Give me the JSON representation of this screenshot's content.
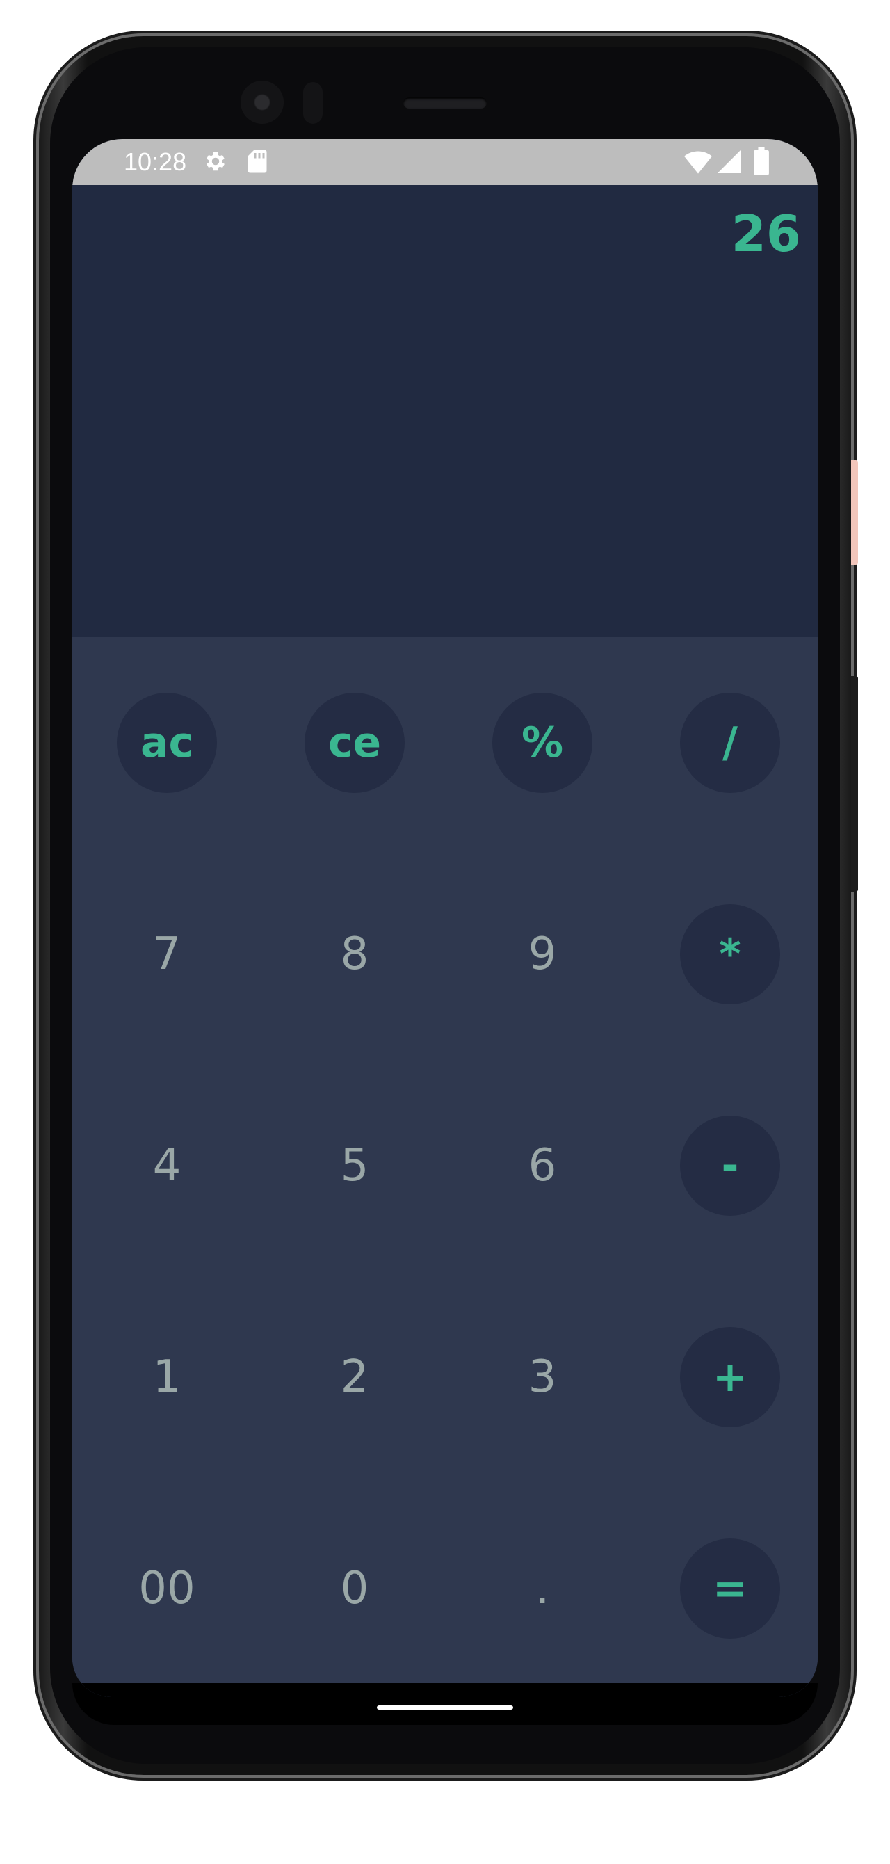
{
  "status_bar": {
    "time": "10:28",
    "icons": [
      "gear-icon",
      "sd-card-icon",
      "wifi-icon",
      "signal-icon",
      "battery-icon"
    ],
    "background": "#bdbdbd"
  },
  "display": {
    "value": "26",
    "background": "#212a41",
    "text_color": "#3ab690"
  },
  "keypad": {
    "background": "#2f384f",
    "operator_color": "#3ab690",
    "number_color": "#9aa7a7",
    "rows": [
      [
        "ac",
        "ce",
        "%",
        "/"
      ],
      [
        "7",
        "8",
        "9",
        "*"
      ],
      [
        "4",
        "5",
        "6",
        "-"
      ],
      [
        "1",
        "2",
        "3",
        "+"
      ],
      [
        "00",
        "0",
        ".",
        "="
      ]
    ]
  }
}
